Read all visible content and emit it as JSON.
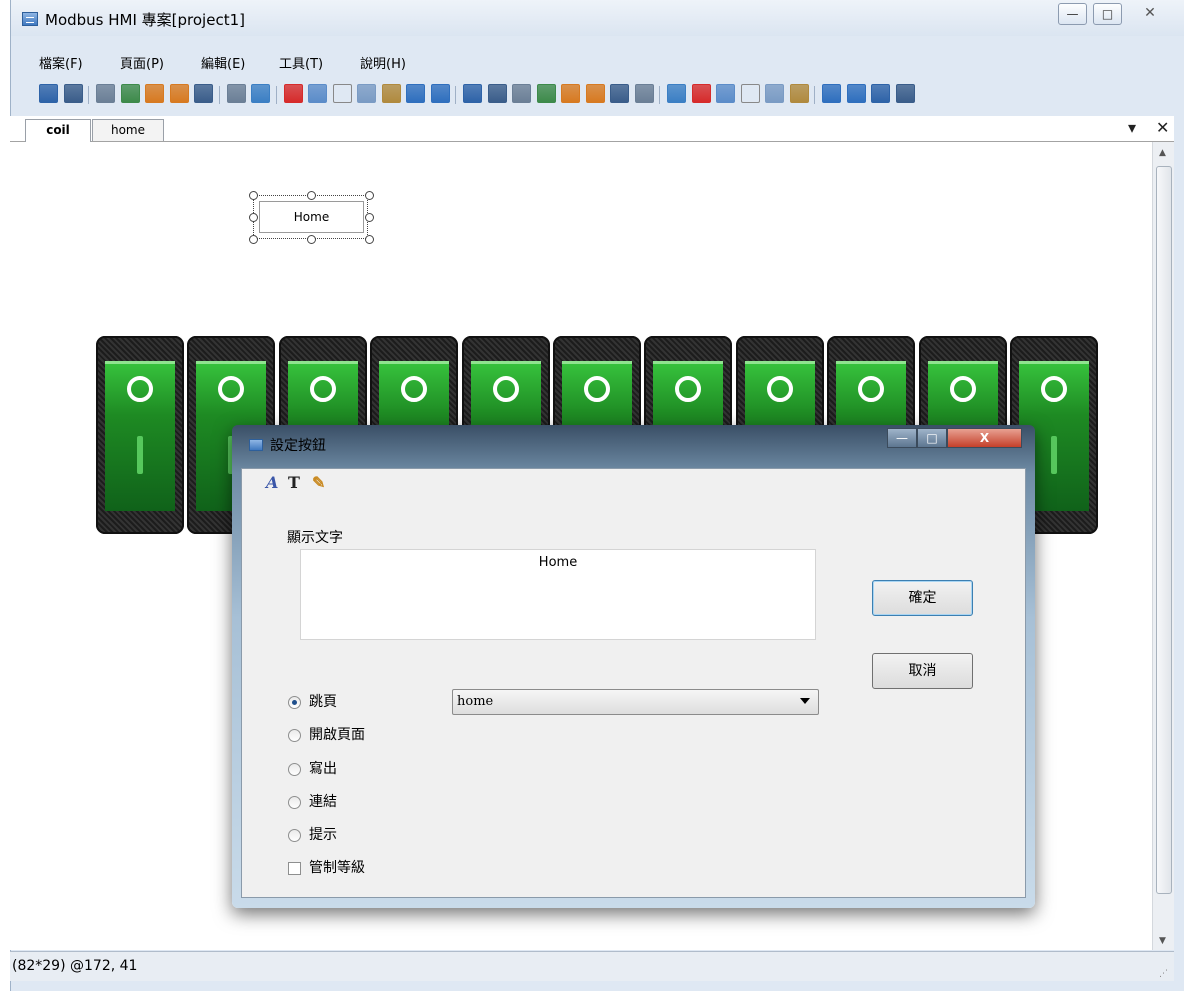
{
  "window": {
    "title": "Modbus HMI 專案[project1]",
    "controls": {
      "minimize": "—",
      "maximize": "□",
      "close": "✕"
    }
  },
  "menu": [
    "檔案(F)",
    "頁面(P)",
    "編輯(E)",
    "工具(T)",
    "說明(H)"
  ],
  "toolbar_icons": [
    "save-as-icon",
    "save-icon",
    "page-menu-icon",
    "add-page-icon",
    "add-page-2-icon",
    "edit-page-icon",
    "page-window-icon",
    "settings-icon",
    "preview-icon",
    "delete-icon",
    "cut-icon",
    "copy-doc-icon",
    "copy-icon",
    "paste-icon",
    "undo-icon",
    "redo-icon",
    "bring-front-icon",
    "send-back-icon",
    "align-left-icon",
    "align-center-icon",
    "align-right-icon",
    "distribute-h-icon",
    "center-h-icon",
    "spread-h-icon",
    "align-top-icon",
    "align-middle-icon",
    "align-bottom-icon",
    "distribute-v-icon",
    "center-v-icon",
    "spread-v-icon",
    "list-icon",
    "paint-icon",
    "italic-font-icon",
    "text-font-icon"
  ],
  "tabs": {
    "items": [
      "coil",
      "home"
    ],
    "active": "coil",
    "menu_glyph": "▾",
    "close_glyph": "✕"
  },
  "canvas": {
    "selected_button_text": "Home",
    "switch_count": 11,
    "switch_glyph": ""
  },
  "dialog": {
    "title": "設定按鈕",
    "controls": {
      "minimize": "—",
      "maximize": "□",
      "close": "X"
    },
    "toolbar_glyphs": {
      "italic": "A",
      "text": "T",
      "paint": "✎"
    },
    "display_text_label": "顯示文字",
    "display_text_value": "Home",
    "ok_label": "確定",
    "cancel_label": "取消",
    "options": [
      {
        "label": "跳頁",
        "checked": true
      },
      {
        "label": "開啟頁面",
        "checked": false
      },
      {
        "label": "寫出",
        "checked": false
      },
      {
        "label": "連結",
        "checked": false
      },
      {
        "label": "提示",
        "checked": false
      }
    ],
    "checkbox": {
      "label": "管制等級",
      "checked": false
    },
    "page_select_value": "home"
  },
  "status": {
    "text": "(82*29) @172, 41"
  }
}
